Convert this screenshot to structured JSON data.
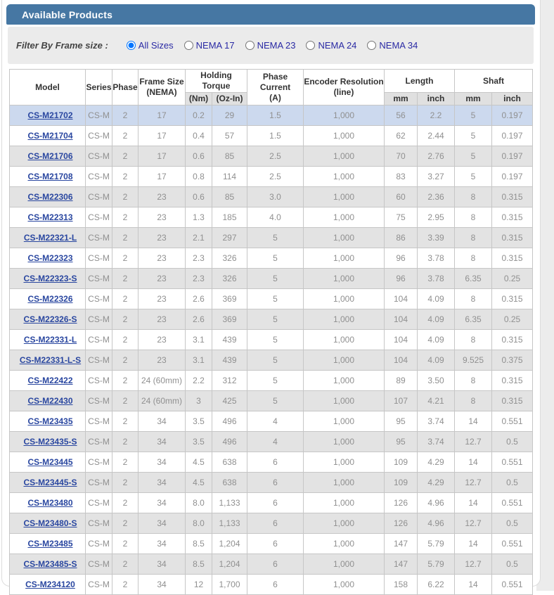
{
  "header": {
    "title": "Available Products"
  },
  "filter": {
    "label": "Filter By Frame size :",
    "options": [
      {
        "label": "All Sizes",
        "selected": true
      },
      {
        "label": "NEMA 17",
        "selected": false
      },
      {
        "label": "NEMA 23",
        "selected": false
      },
      {
        "label": "NEMA 24",
        "selected": false
      },
      {
        "label": "NEMA 34",
        "selected": false
      }
    ]
  },
  "table": {
    "columns": {
      "model": "Model",
      "series": "Series",
      "phase": "Phase",
      "frame_size_line1": "Frame Size",
      "frame_size_line2": "(NEMA)",
      "holding_torque": "Holding Torque",
      "holding_torque_nm": "(Nm)",
      "holding_torque_ozin": "(Oz-In)",
      "phase_current_line1": "Phase Current",
      "phase_current_line2": "(A)",
      "encoder_line1": "Encoder Resolution",
      "encoder_line2": "(line)",
      "length": "Length",
      "length_mm": "mm",
      "length_inch": "inch",
      "shaft": "Shaft",
      "shaft_mm": "mm",
      "shaft_inch": "inch"
    },
    "highlighted_row_index": 0,
    "rows": [
      [
        "CS-M21702",
        "CS-M",
        "2",
        "17",
        "0.2",
        "29",
        "1.5",
        "1,000",
        "56",
        "2.2",
        "5",
        "0.197"
      ],
      [
        "CS-M21704",
        "CS-M",
        "2",
        "17",
        "0.4",
        "57",
        "1.5",
        "1,000",
        "62",
        "2.44",
        "5",
        "0.197"
      ],
      [
        "CS-M21706",
        "CS-M",
        "2",
        "17",
        "0.6",
        "85",
        "2.5",
        "1,000",
        "70",
        "2.76",
        "5",
        "0.197"
      ],
      [
        "CS-M21708",
        "CS-M",
        "2",
        "17",
        "0.8",
        "114",
        "2.5",
        "1,000",
        "83",
        "3.27",
        "5",
        "0.197"
      ],
      [
        "CS-M22306",
        "CS-M",
        "2",
        "23",
        "0.6",
        "85",
        "3.0",
        "1,000",
        "60",
        "2.36",
        "8",
        "0.315"
      ],
      [
        "CS-M22313",
        "CS-M",
        "2",
        "23",
        "1.3",
        "185",
        "4.0",
        "1,000",
        "75",
        "2.95",
        "8",
        "0.315"
      ],
      [
        "CS-M22321-L",
        "CS-M",
        "2",
        "23",
        "2.1",
        "297",
        "5",
        "1,000",
        "86",
        "3.39",
        "8",
        "0.315"
      ],
      [
        "CS-M22323",
        "CS-M",
        "2",
        "23",
        "2.3",
        "326",
        "5",
        "1,000",
        "96",
        "3.78",
        "8",
        "0.315"
      ],
      [
        "CS-M22323-S",
        "CS-M",
        "2",
        "23",
        "2.3",
        "326",
        "5",
        "1,000",
        "96",
        "3.78",
        "6.35",
        "0.25"
      ],
      [
        "CS-M22326",
        "CS-M",
        "2",
        "23",
        "2.6",
        "369",
        "5",
        "1,000",
        "104",
        "4.09",
        "8",
        "0.315"
      ],
      [
        "CS-M22326-S",
        "CS-M",
        "2",
        "23",
        "2.6",
        "369",
        "5",
        "1,000",
        "104",
        "4.09",
        "6.35",
        "0.25"
      ],
      [
        "CS-M22331-L",
        "CS-M",
        "2",
        "23",
        "3.1",
        "439",
        "5",
        "1,000",
        "104",
        "4.09",
        "8",
        "0.315"
      ],
      [
        "CS-M22331-L-S",
        "CS-M",
        "2",
        "23",
        "3.1",
        "439",
        "5",
        "1,000",
        "104",
        "4.09",
        "9.525",
        "0.375"
      ],
      [
        "CS-M22422",
        "CS-M",
        "2",
        "24 (60mm)",
        "2.2",
        "312",
        "5",
        "1,000",
        "89",
        "3.50",
        "8",
        "0.315"
      ],
      [
        "CS-M22430",
        "CS-M",
        "2",
        "24 (60mm)",
        "3",
        "425",
        "5",
        "1,000",
        "107",
        "4.21",
        "8",
        "0.315"
      ],
      [
        "CS-M23435",
        "CS-M",
        "2",
        "34",
        "3.5",
        "496",
        "4",
        "1,000",
        "95",
        "3.74",
        "14",
        "0.551"
      ],
      [
        "CS-M23435-S",
        "CS-M",
        "2",
        "34",
        "3.5",
        "496",
        "4",
        "1,000",
        "95",
        "3.74",
        "12.7",
        "0.5"
      ],
      [
        "CS-M23445",
        "CS-M",
        "2",
        "34",
        "4.5",
        "638",
        "6",
        "1,000",
        "109",
        "4.29",
        "14",
        "0.551"
      ],
      [
        "CS-M23445-S",
        "CS-M",
        "2",
        "34",
        "4.5",
        "638",
        "6",
        "1,000",
        "109",
        "4.29",
        "12.7",
        "0.5"
      ],
      [
        "CS-M23480",
        "CS-M",
        "2",
        "34",
        "8.0",
        "1,133",
        "6",
        "1,000",
        "126",
        "4.96",
        "14",
        "0.551"
      ],
      [
        "CS-M23480-S",
        "CS-M",
        "2",
        "34",
        "8.0",
        "1,133",
        "6",
        "1,000",
        "126",
        "4.96",
        "12.7",
        "0.5"
      ],
      [
        "CS-M23485",
        "CS-M",
        "2",
        "34",
        "8.5",
        "1,204",
        "6",
        "1,000",
        "147",
        "5.79",
        "14",
        "0.551"
      ],
      [
        "CS-M23485-S",
        "CS-M",
        "2",
        "34",
        "8.5",
        "1,204",
        "6",
        "1,000",
        "147",
        "5.79",
        "12.7",
        "0.5"
      ],
      [
        "CS-M234120",
        "CS-M",
        "2",
        "34",
        "12",
        "1,700",
        "6",
        "1,000",
        "158",
        "6.22",
        "14",
        "0.551"
      ]
    ]
  },
  "colors": {
    "header_bar_bg": "#4677a3",
    "highlight_row_bg": "#ccd9ee",
    "subheader_bg": "#e0e0e0",
    "link_color": "#2a47a0",
    "radio_label_color": "#2a2aa4"
  }
}
